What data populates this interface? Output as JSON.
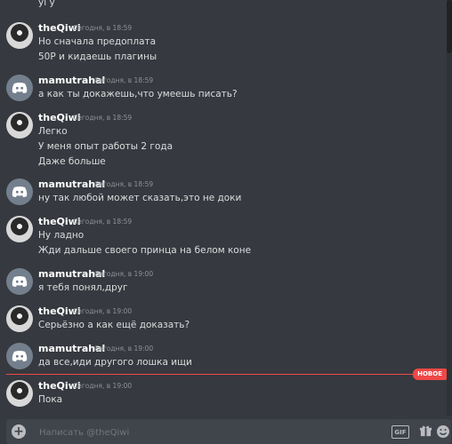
{
  "prev_message_fragment": "уі у",
  "messages": [
    {
      "user": "theQiwi",
      "avatar": "qiwi",
      "time": "Сегодня, в 18:59",
      "lines": [
        "Но сначала предоплата",
        "50Р и кидаешь плагины"
      ]
    },
    {
      "user": "mamutrahal",
      "avatar": "discord",
      "time": "Сегодня, в 18:59",
      "lines": [
        "а как ты докажешь,что умеешь писать?"
      ]
    },
    {
      "user": "theQiwi",
      "avatar": "qiwi",
      "time": "Сегодня, в 18:59",
      "lines": [
        "Легко",
        "У меня опыт работы 2 года",
        "Даже больше"
      ]
    },
    {
      "user": "mamutrahal",
      "avatar": "discord",
      "time": "Сегодня, в 18:59",
      "lines": [
        "ну так любой может сказать,это не доки"
      ]
    },
    {
      "user": "theQiwi",
      "avatar": "qiwi",
      "time": "Сегодня, в 18:59",
      "lines": [
        "Ну ладно",
        "Жди дальше своего принца на белом коне"
      ]
    },
    {
      "user": "mamutrahal",
      "avatar": "discord",
      "time": "Сегодня, в 19:00",
      "lines": [
        "я тебя понял,друг"
      ]
    },
    {
      "user": "theQiwi",
      "avatar": "qiwi",
      "time": "Сегодня, в 19:00",
      "lines": [
        "Серьёзно а как ещё доказать?"
      ]
    },
    {
      "user": "mamutrahal",
      "avatar": "discord",
      "time": "Сегодня, в 19:00",
      "lines": [
        "да все,иди другого лошка ищи"
      ]
    },
    {
      "user": "theQiwi",
      "avatar": "qiwi",
      "time": "Сегодня, в 19:00",
      "lines": [
        "Пока"
      ]
    }
  ],
  "new_badge": "НОВОЕ",
  "composer": {
    "placeholder": "Написать @theQiwi",
    "attach_label": "+",
    "gif_label": "GIF"
  },
  "colors": {
    "background": "#36393f",
    "composer": "#40444b",
    "new_divider": "#f04747",
    "username": "#ffffff",
    "timestamp": "#8e9297"
  },
  "icons": {
    "attach": "plus-circle-icon",
    "gif": "gif-icon",
    "gift": "gift-icon",
    "emoji": "emoji-icon",
    "discord_avatar": "discord-logo-icon"
  }
}
